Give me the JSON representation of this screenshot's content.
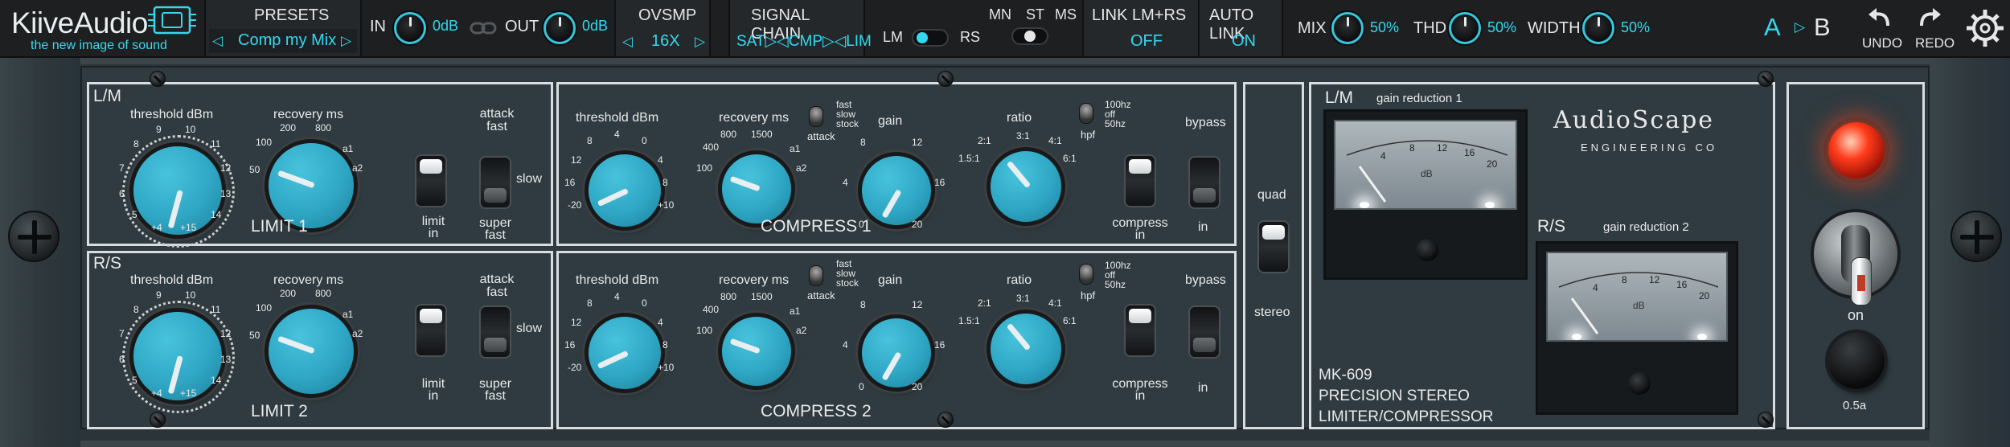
{
  "brand": {
    "title": "KiiveAudio",
    "subtitle": "the new image of sound"
  },
  "presets": {
    "label": "PRESETS",
    "value": "Comp my Mix",
    "prev": "◁",
    "next": "▷"
  },
  "io": {
    "in_label": "IN",
    "in_value": "0dB",
    "out_label": "OUT",
    "out_value": "0dB"
  },
  "oversample": {
    "label": "OVSMP",
    "value": "16X",
    "prev": "◁",
    "next": "▷"
  },
  "signal_chain": {
    "label": "SIGNAL CHAIN",
    "value": "SAT▷◁CMP▷◁LIM"
  },
  "mode": {
    "lm": "LM",
    "rs": "RS",
    "mn": "MN",
    "st": "ST",
    "ms": "MS"
  },
  "link": {
    "label": "LINK LM+RS",
    "value": "OFF"
  },
  "autolink": {
    "label": "AUTO LINK",
    "value": "ON"
  },
  "mix": {
    "label": "MIX",
    "value": "50%"
  },
  "thd": {
    "label": "THD",
    "value": "50%"
  },
  "width": {
    "label": "WIDTH",
    "value": "50%"
  },
  "ab": {
    "a": "A",
    "b": "B",
    "arrow": "▷"
  },
  "undo": "UNDO",
  "redo": "REDO",
  "limit": {
    "ch1_label": "L/M",
    "ch2_label": "R/S",
    "threshold_label": "threshold dBm",
    "threshold_ticks": [
      "9",
      "10",
      "8",
      "11",
      "7",
      "12",
      "6",
      "13",
      "5",
      "14",
      "+4",
      "+15"
    ],
    "recovery_label": "recovery ms",
    "recovery_ticks": [
      "200",
      "800",
      "100",
      "a1",
      "50",
      "a2"
    ],
    "limit_in": "limit in",
    "attack_label": "attack fast",
    "slow": "slow",
    "super_fast": "super fast",
    "title1": "LIMIT 1",
    "title2": "LIMIT 2"
  },
  "compress": {
    "threshold_label": "threshold dBm",
    "threshold_ticks": [
      "4",
      "8",
      "0",
      "12",
      "4",
      "16",
      "8",
      "-20",
      "+10"
    ],
    "recovery_label": "recovery ms",
    "recovery_ticks": [
      "800",
      "1500",
      "400",
      "100",
      "a1",
      "a2"
    ],
    "attack_opts": [
      "fast",
      "slow",
      "stock"
    ],
    "attack_label": "attack",
    "gain_label": "gain",
    "gain_ticks": [
      "8",
      "12",
      "4",
      "16",
      "0",
      "20"
    ],
    "ratio_label": "ratio",
    "ratio_ticks": [
      "3:1",
      "2:1",
      "4:1",
      "1.5:1",
      "6:1"
    ],
    "hpf_opts": [
      "100hz",
      "off",
      "50hz"
    ],
    "hpf_label": "hpf",
    "bypass_label": "bypass",
    "compress_in": "compress in",
    "in": "in",
    "title1": "COMPRESS 1",
    "title2": "COMPRESS 2"
  },
  "quad": {
    "top": "quad",
    "bottom": "stereo"
  },
  "meters": {
    "lm_label": "L/M",
    "rs_label": "R/S",
    "gr1": "gain reduction 1",
    "gr2": "gain reduction 2",
    "scale": [
      "4",
      "8",
      "12",
      "16",
      "20"
    ],
    "unit": "dB"
  },
  "logo": {
    "name": "AudioScape",
    "sub": "ENGINEERING CO"
  },
  "model": {
    "line1": "MK-609",
    "line2": "PRECISION STEREO",
    "line3": "LIMITER/COMPRESSOR"
  },
  "power": {
    "label": "on",
    "knob_value": "0.5a"
  },
  "colors": {
    "accent": "#34d9ef",
    "knob": "#2ea6c4",
    "panel": "#2f3b40",
    "led": "#ff3b1a"
  }
}
